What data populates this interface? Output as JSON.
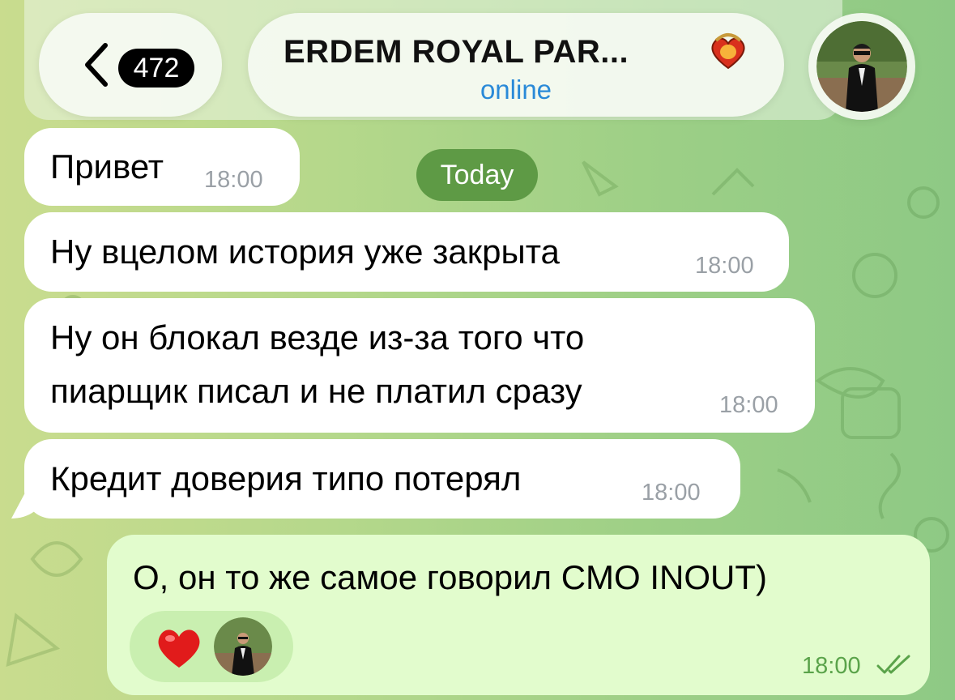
{
  "header": {
    "back_count": "472",
    "chat_title": "ERDEM ROYAL PAR...",
    "status": "online"
  },
  "date_separator": "Today",
  "messages": [
    {
      "text": "Привет",
      "time": "18:00",
      "direction": "incoming"
    },
    {
      "text": "Ну вцелом история уже закрыта",
      "time": "18:00",
      "direction": "incoming"
    },
    {
      "line1": "Ну он блокал везде из-за того что",
      "line2": "пиарщик писал и не платил сразу",
      "time": "18:00",
      "direction": "incoming"
    },
    {
      "text": "Кредит доверия типо потерял",
      "time": "18:00",
      "direction": "incoming"
    },
    {
      "text": "О, он то же самое говорил CMO INOUT)",
      "time": "18:00",
      "direction": "outgoing",
      "reaction": "heart-icon",
      "status": "read-double-check"
    }
  ],
  "colors": {
    "incoming_bubble": "#ffffff",
    "outgoing_bubble": "#e2fccd",
    "accent_blue": "#2a8ad8",
    "date_pill": "#5e9a45",
    "outgoing_meta": "#5aa34a"
  }
}
